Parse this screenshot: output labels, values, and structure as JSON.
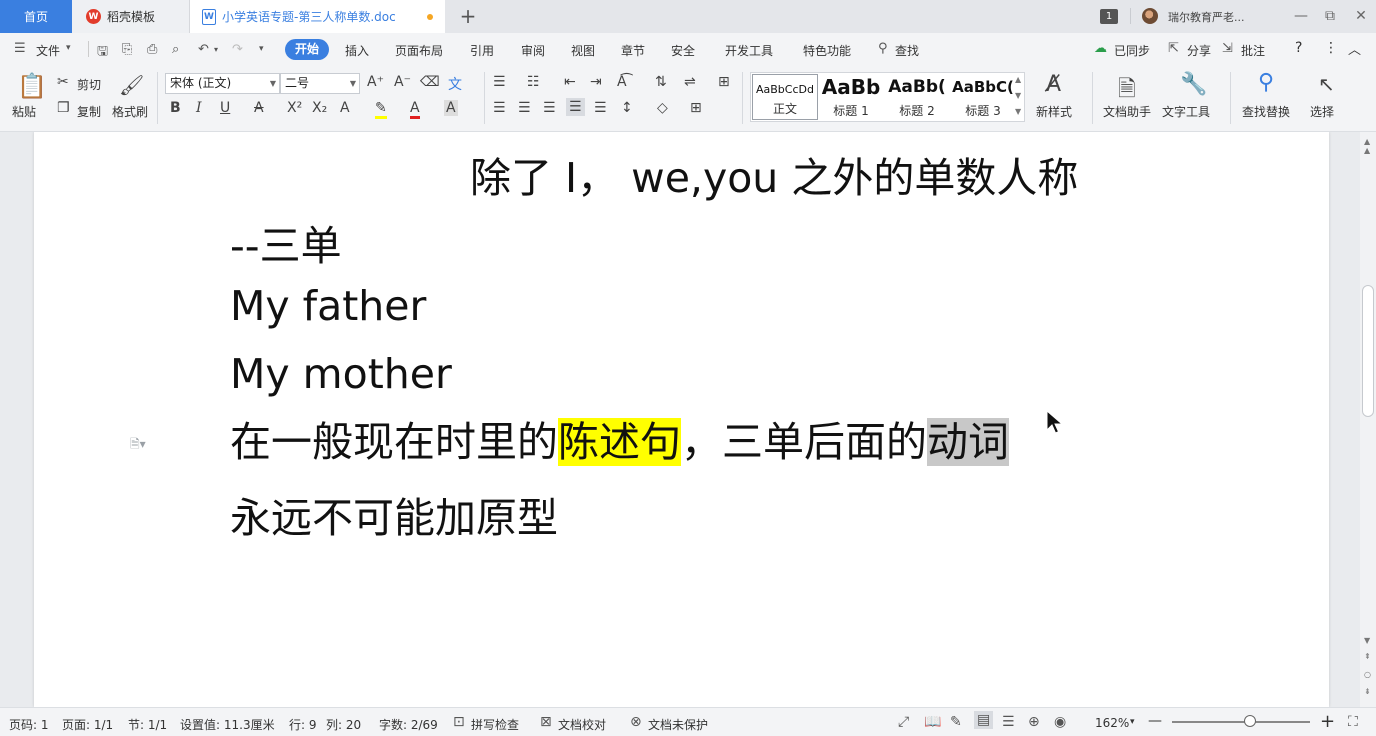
{
  "tabs": {
    "home": "首页",
    "templates": "稻壳模板",
    "document": "小学英语专题-第三人称单数.doc",
    "new_tab": "+"
  },
  "titlebar": {
    "window_count": "1",
    "user_name": "瑞尔教育严老...",
    "minimize": "—",
    "restore": "⧉",
    "close": "✕"
  },
  "menubar": {
    "file": "文件",
    "items": [
      "开始",
      "插入",
      "页面布局",
      "引用",
      "审阅",
      "视图",
      "章节",
      "安全",
      "开发工具",
      "特色功能"
    ],
    "search": "查找",
    "sync": "已同步",
    "share": "分享",
    "comment": "批注",
    "help": "?",
    "more": "⋮",
    "collapse": "︿"
  },
  "ribbon": {
    "paste": "粘贴",
    "cut": "剪切",
    "copy": "复制",
    "format_painter": "格式刷",
    "font_name": "宋体 (正文)",
    "font_size": "二号",
    "styles": [
      {
        "sample": "AaBbCcDd",
        "name": "正文"
      },
      {
        "sample": "AaBb",
        "name": "标题 1"
      },
      {
        "sample": "AaBb(",
        "name": "标题 2"
      },
      {
        "sample": "AaBbC(",
        "name": "标题 3"
      }
    ],
    "new_style": "新样式",
    "doc_assistant": "文档助手",
    "text_tools": "文字工具",
    "find_replace": "查找替换",
    "select": "选择"
  },
  "document": {
    "line1": "除了 I， we,you 之外的单数人称",
    "line2": "--三单",
    "line3": "My father",
    "line4": "My mother",
    "line5_a": "在一般现在时里的",
    "line5_hl": "陈述句",
    "line5_b": "，三单后面的",
    "line5_sel": "动词",
    "line6": "永远不可能加原型"
  },
  "statusbar": {
    "page_num": "页码: 1",
    "pages": "页面: 1/1",
    "section": "节: 1/1",
    "position": "设置值: 11.3厘米",
    "row": "行: 9",
    "col": "列: 20",
    "word_count": "字数: 2/69",
    "spell_check": "拼写检查",
    "doc_proof": "文档校对",
    "protection": "文档未保护",
    "zoom": "162%",
    "zoom_minus": "—",
    "zoom_plus": "+"
  },
  "colors": {
    "accent": "#3a7fe0",
    "highlight_yellow": "#ffff00",
    "selection_gray": "#c8c8c8"
  }
}
